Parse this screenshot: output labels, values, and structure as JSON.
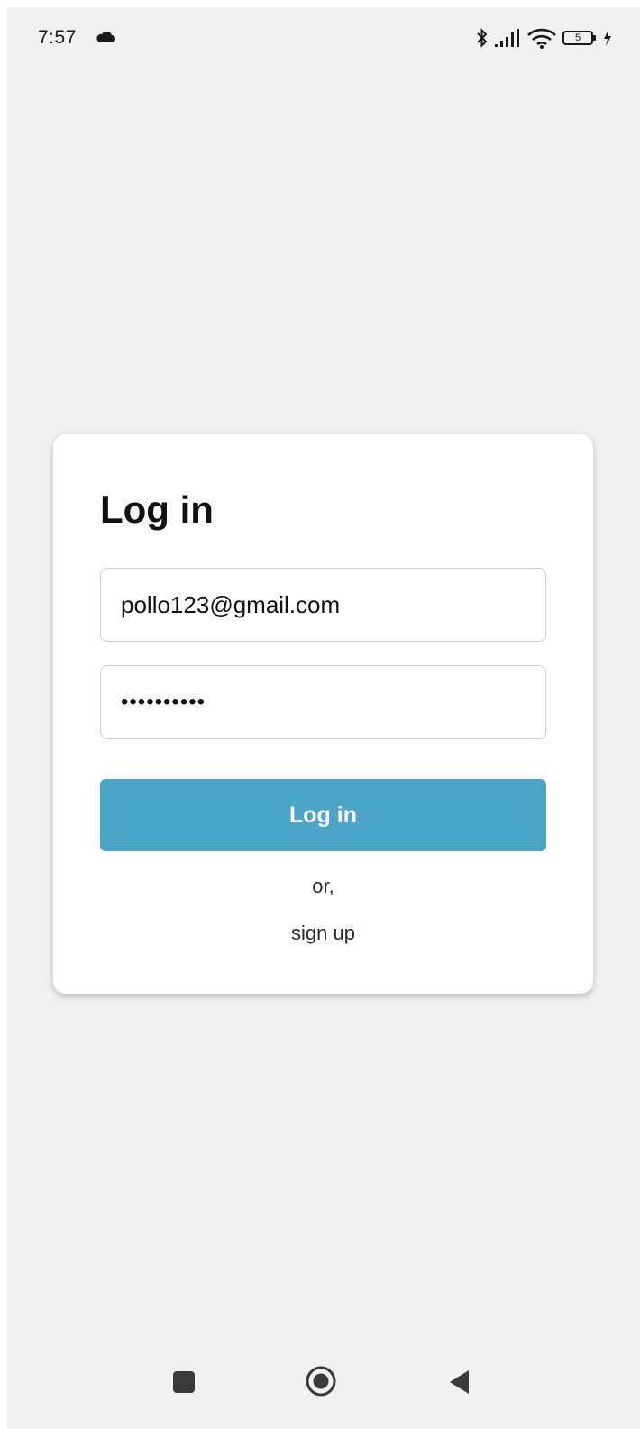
{
  "status_bar": {
    "time": "7:57",
    "battery_level": "5",
    "icons": [
      "cloud-icon",
      "bluetooth-icon",
      "signal-icon",
      "wifi-icon",
      "battery-icon",
      "charging-icon"
    ]
  },
  "login_card": {
    "title": "Log in",
    "email_value": "pollo123@gmail.com",
    "password_value": "••••••••••",
    "login_button_label": "Log in",
    "or_text": "or,",
    "signup_label": "sign up"
  },
  "nav_bar": {
    "icons": [
      "recents-icon",
      "home-icon",
      "back-icon"
    ]
  },
  "colors": {
    "accent": "#4aa5c7",
    "background": "#f1f1f1",
    "card": "#ffffff"
  }
}
